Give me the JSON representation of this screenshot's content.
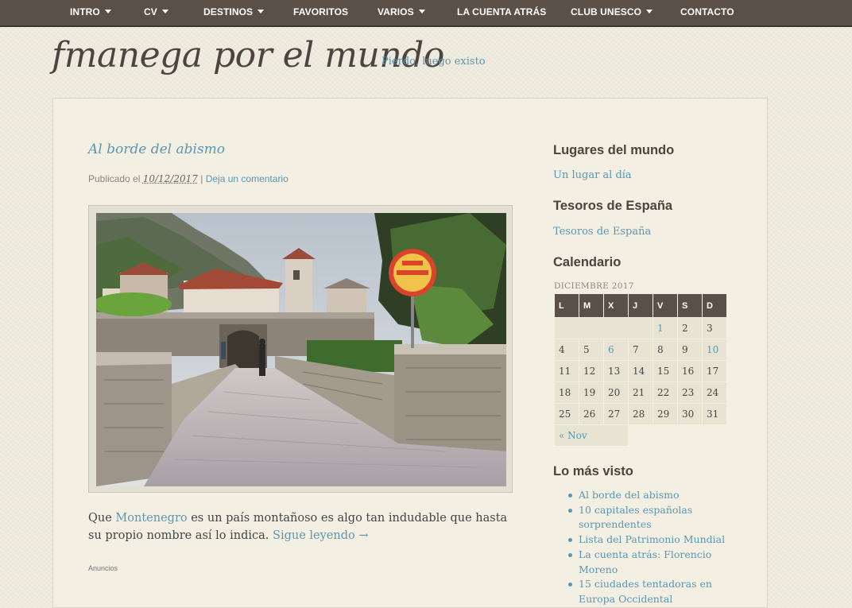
{
  "nav": {
    "items": [
      {
        "label": "INTRO",
        "dropdown": true
      },
      {
        "label": "CV",
        "dropdown": true
      },
      {
        "label": "DESTINOS",
        "dropdown": true
      },
      {
        "label": "FAVORITOS",
        "dropdown": false
      },
      {
        "label": "VARIOS",
        "dropdown": true
      },
      {
        "label": "LA CUENTA ATRÁS",
        "dropdown": false
      },
      {
        "label": "CLUB UNESCO",
        "dropdown": true
      },
      {
        "label": "CONTACTO",
        "dropdown": false
      }
    ]
  },
  "header": {
    "title": "fmanega por el mundo",
    "tagline": "Pierdo, luego existo"
  },
  "post": {
    "title": "Al borde del abismo",
    "meta_prefix": "Publicado el",
    "date": "10/12/2017",
    "separator": "|",
    "comment_link": "Deja un comentario",
    "excerpt_before": "Que",
    "excerpt_link": "Montenegro",
    "excerpt_after": "es un país montañoso es algo tan indudable que hasta su propio nombre así lo indica.",
    "read_more": "Sigue leyendo →",
    "ads_label": "Anuncios"
  },
  "sidebar": {
    "widget1_title": "Lugares del mundo",
    "widget1_link": "Un lugar al día",
    "widget2_title": "Tesoros de España",
    "widget2_link": "Tesoros de España",
    "calendar_title": "Calendario",
    "calendar": {
      "caption": "DICIEMBRE 2017",
      "weekdays": [
        "L",
        "M",
        "X",
        "J",
        "V",
        "S",
        "D"
      ],
      "rows": [
        [
          "",
          "",
          "",
          "",
          "1",
          "2",
          "3"
        ],
        [
          "4",
          "5",
          "6",
          "7",
          "8",
          "9",
          "10"
        ],
        [
          "11",
          "12",
          "13",
          "14",
          "15",
          "16",
          "17"
        ],
        [
          "18",
          "19",
          "20",
          "21",
          "22",
          "23",
          "24"
        ],
        [
          "25",
          "26",
          "27",
          "28",
          "29",
          "30",
          "31"
        ]
      ],
      "linked_days": [
        "1",
        "6",
        "10"
      ],
      "prev_link": "« Nov"
    },
    "popular_title": "Lo más visto",
    "popular": [
      "Al borde del abismo",
      "10 capitales españolas sorprendentes",
      "Lista del Patrimonio Mundial",
      "La cuenta atrás: Florencio Moreno",
      "15 ciudades tentadoras en Europa Occidental"
    ]
  },
  "colors": {
    "nav_bg": "#5a5048",
    "link": "#5b96b0",
    "page_bg": "#f0ede0",
    "content_bg": "#f3f0e3"
  }
}
